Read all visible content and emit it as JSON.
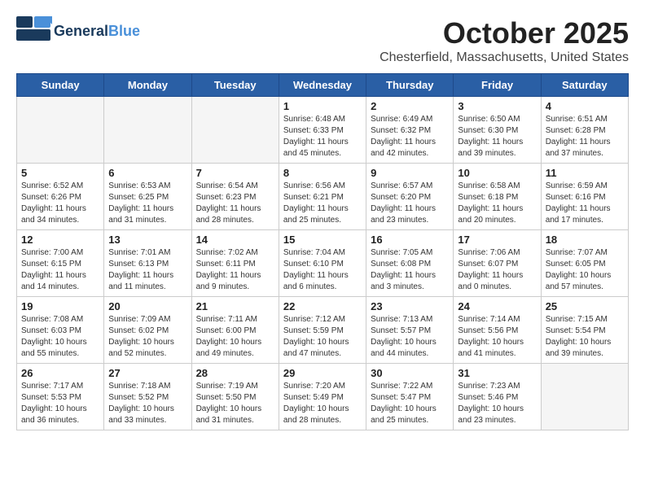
{
  "header": {
    "logo_general": "General",
    "logo_blue": "Blue",
    "title": "October 2025",
    "subtitle": "Chesterfield, Massachusetts, United States"
  },
  "days_of_week": [
    "Sunday",
    "Monday",
    "Tuesday",
    "Wednesday",
    "Thursday",
    "Friday",
    "Saturday"
  ],
  "weeks": [
    [
      {
        "day": "",
        "info": ""
      },
      {
        "day": "",
        "info": ""
      },
      {
        "day": "",
        "info": ""
      },
      {
        "day": "1",
        "info": "Sunrise: 6:48 AM\nSunset: 6:33 PM\nDaylight: 11 hours\nand 45 minutes."
      },
      {
        "day": "2",
        "info": "Sunrise: 6:49 AM\nSunset: 6:32 PM\nDaylight: 11 hours\nand 42 minutes."
      },
      {
        "day": "3",
        "info": "Sunrise: 6:50 AM\nSunset: 6:30 PM\nDaylight: 11 hours\nand 39 minutes."
      },
      {
        "day": "4",
        "info": "Sunrise: 6:51 AM\nSunset: 6:28 PM\nDaylight: 11 hours\nand 37 minutes."
      }
    ],
    [
      {
        "day": "5",
        "info": "Sunrise: 6:52 AM\nSunset: 6:26 PM\nDaylight: 11 hours\nand 34 minutes."
      },
      {
        "day": "6",
        "info": "Sunrise: 6:53 AM\nSunset: 6:25 PM\nDaylight: 11 hours\nand 31 minutes."
      },
      {
        "day": "7",
        "info": "Sunrise: 6:54 AM\nSunset: 6:23 PM\nDaylight: 11 hours\nand 28 minutes."
      },
      {
        "day": "8",
        "info": "Sunrise: 6:56 AM\nSunset: 6:21 PM\nDaylight: 11 hours\nand 25 minutes."
      },
      {
        "day": "9",
        "info": "Sunrise: 6:57 AM\nSunset: 6:20 PM\nDaylight: 11 hours\nand 23 minutes."
      },
      {
        "day": "10",
        "info": "Sunrise: 6:58 AM\nSunset: 6:18 PM\nDaylight: 11 hours\nand 20 minutes."
      },
      {
        "day": "11",
        "info": "Sunrise: 6:59 AM\nSunset: 6:16 PM\nDaylight: 11 hours\nand 17 minutes."
      }
    ],
    [
      {
        "day": "12",
        "info": "Sunrise: 7:00 AM\nSunset: 6:15 PM\nDaylight: 11 hours\nand 14 minutes."
      },
      {
        "day": "13",
        "info": "Sunrise: 7:01 AM\nSunset: 6:13 PM\nDaylight: 11 hours\nand 11 minutes."
      },
      {
        "day": "14",
        "info": "Sunrise: 7:02 AM\nSunset: 6:11 PM\nDaylight: 11 hours\nand 9 minutes."
      },
      {
        "day": "15",
        "info": "Sunrise: 7:04 AM\nSunset: 6:10 PM\nDaylight: 11 hours\nand 6 minutes."
      },
      {
        "day": "16",
        "info": "Sunrise: 7:05 AM\nSunset: 6:08 PM\nDaylight: 11 hours\nand 3 minutes."
      },
      {
        "day": "17",
        "info": "Sunrise: 7:06 AM\nSunset: 6:07 PM\nDaylight: 11 hours\nand 0 minutes."
      },
      {
        "day": "18",
        "info": "Sunrise: 7:07 AM\nSunset: 6:05 PM\nDaylight: 10 hours\nand 57 minutes."
      }
    ],
    [
      {
        "day": "19",
        "info": "Sunrise: 7:08 AM\nSunset: 6:03 PM\nDaylight: 10 hours\nand 55 minutes."
      },
      {
        "day": "20",
        "info": "Sunrise: 7:09 AM\nSunset: 6:02 PM\nDaylight: 10 hours\nand 52 minutes."
      },
      {
        "day": "21",
        "info": "Sunrise: 7:11 AM\nSunset: 6:00 PM\nDaylight: 10 hours\nand 49 minutes."
      },
      {
        "day": "22",
        "info": "Sunrise: 7:12 AM\nSunset: 5:59 PM\nDaylight: 10 hours\nand 47 minutes."
      },
      {
        "day": "23",
        "info": "Sunrise: 7:13 AM\nSunset: 5:57 PM\nDaylight: 10 hours\nand 44 minutes."
      },
      {
        "day": "24",
        "info": "Sunrise: 7:14 AM\nSunset: 5:56 PM\nDaylight: 10 hours\nand 41 minutes."
      },
      {
        "day": "25",
        "info": "Sunrise: 7:15 AM\nSunset: 5:54 PM\nDaylight: 10 hours\nand 39 minutes."
      }
    ],
    [
      {
        "day": "26",
        "info": "Sunrise: 7:17 AM\nSunset: 5:53 PM\nDaylight: 10 hours\nand 36 minutes."
      },
      {
        "day": "27",
        "info": "Sunrise: 7:18 AM\nSunset: 5:52 PM\nDaylight: 10 hours\nand 33 minutes."
      },
      {
        "day": "28",
        "info": "Sunrise: 7:19 AM\nSunset: 5:50 PM\nDaylight: 10 hours\nand 31 minutes."
      },
      {
        "day": "29",
        "info": "Sunrise: 7:20 AM\nSunset: 5:49 PM\nDaylight: 10 hours\nand 28 minutes."
      },
      {
        "day": "30",
        "info": "Sunrise: 7:22 AM\nSunset: 5:47 PM\nDaylight: 10 hours\nand 25 minutes."
      },
      {
        "day": "31",
        "info": "Sunrise: 7:23 AM\nSunset: 5:46 PM\nDaylight: 10 hours\nand 23 minutes."
      },
      {
        "day": "",
        "info": ""
      }
    ]
  ]
}
